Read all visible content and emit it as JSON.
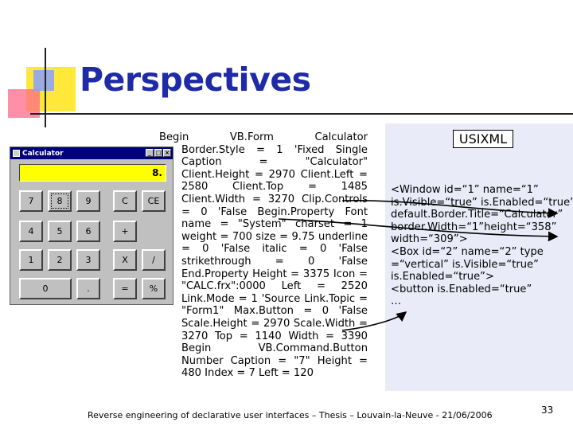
{
  "slide": {
    "title": "Perspectives",
    "footer": "Reverse engineering of declarative user interfaces – Thesis – Louvain-la-Neuve - 21/06/2006",
    "page_number": "33"
  },
  "calculator": {
    "window_title": "Calculator",
    "display_value": "8.",
    "controls": [
      "_",
      "□",
      "×"
    ],
    "buttons": [
      "7",
      "8",
      "9",
      "C",
      "CE",
      "4",
      "5",
      "6",
      "+",
      "1",
      "2",
      "3",
      "X",
      "/",
      "0",
      ".",
      "=",
      "%"
    ]
  },
  "vb_code": {
    "first_line": "Begin VB.Form Calculator",
    "body": "Border.Style = 1 'Fixed Single Caption = \"Calculator\" Client.Height = 2970 Client.Left = 2580 Client.Top = 1485 Client.Width = 3270 Clip.Controls = 0 'False Begin.Property Font name = \"System\" charset = 1 weight = 700 size = 9.75 underline = 0 'False italic = 0 'False strikethrough = 0 'False End.Property Height = 3375 Icon = \"CALC.frx\":0000 Left = 2520 Link.Mode = 1 'Source Link.Topic = \"Form1\" Max.Button = 0 'False Scale.Height = 2970 Scale.Width = 3270 Top = 1140 Width = 3390 Begin VB.Command.Button Number Caption = \"7\" Height = 480 Index = 7 Left = 120"
  },
  "usixml": {
    "label": "USIXML",
    "lines": [
      "<Window id=“1” name=“1”",
      "is.Visible=“true” is.Enabled=“true”",
      "default.Border.Title=“Calculator”",
      "border.Width=“1”height=“358”",
      "width=“309”>",
      "<Box id=“2” name=“2” type",
      "=“vertical” is.Visible=“true”",
      "is.Enabled=“true”>",
      "<button is.Enabled=“true”",
      "…"
    ]
  }
}
